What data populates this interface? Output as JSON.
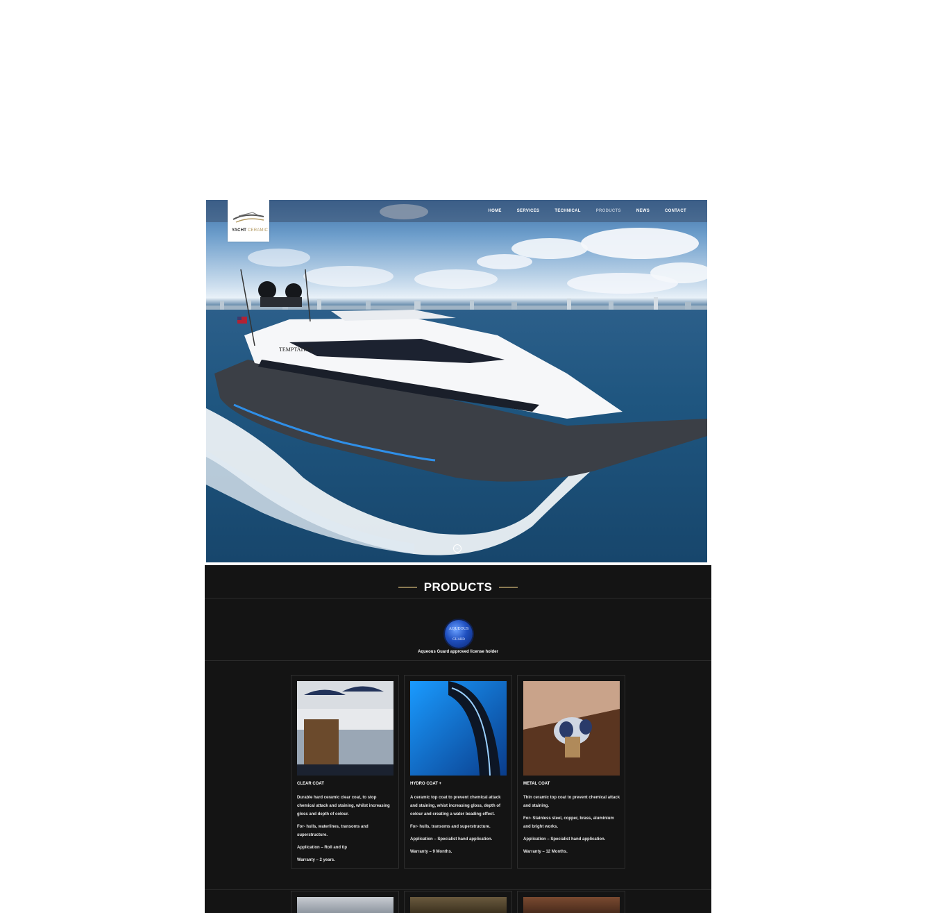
{
  "brand": {
    "logo_main": "YACHT",
    "logo_sub": "CERAMIC"
  },
  "nav": {
    "items": [
      "HOME",
      "SERVICES",
      "TECHNICAL",
      "PRODUCTS",
      "NEWS",
      "CONTACT"
    ],
    "active": "PRODUCTS"
  },
  "hero": {
    "yacht_name": "TEMPTATION",
    "scroll_icon": "chevron-down-icon"
  },
  "products": {
    "title": "PRODUCTS",
    "badge": {
      "line1": "AQUEOUS",
      "line2": "GUARD"
    },
    "badge_caption": "Aqueous Guard approved license holder",
    "cards": [
      {
        "name": "CLEAR COAT",
        "paras": [
          "Durable hard ceramic clear coat, to stop chemical attack and staining, whilst increasing gloss and depth of colour.",
          "For- hulls, waterlines, transoms and superstructure.",
          "Application – Roll and tip",
          "Warranty – 2 years."
        ]
      },
      {
        "name": "HYDRO COAT +",
        "paras": [
          "A ceramic top coat to prevent chemical attack and staining, whist increasing gloss, depth of colour and creating a water beading effect.",
          "For- hulls, transoms and superstructure.",
          "Application – Specialist hand application.",
          "Warranty – 9 Months."
        ]
      },
      {
        "name": "METAL COAT",
        "paras": [
          "Thin ceramic top coat to prevent chemical attack and staining.",
          "For- Stainless steel, copper, brass, aluminium and bright works.",
          "Application – Specialist hand application.",
          "Warranty – 12 Months."
        ]
      }
    ]
  }
}
